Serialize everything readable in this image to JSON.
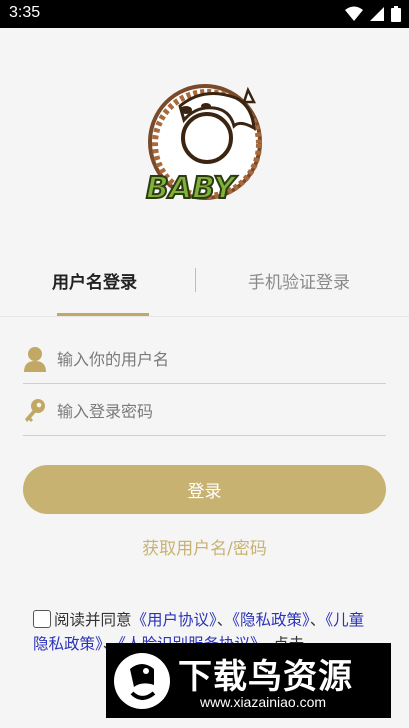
{
  "status_bar": {
    "time": "3:35"
  },
  "logo": {
    "text": "BABY"
  },
  "tabs": [
    {
      "label": "用户名登录",
      "active": true
    },
    {
      "label": "手机验证登录",
      "active": false
    }
  ],
  "form": {
    "username_placeholder": "输入你的用户名",
    "password_placeholder": "输入登录密码",
    "login_label": "登录",
    "retrieve_label": "获取用户名/密码"
  },
  "agreement": {
    "prefix": "阅读并同意",
    "link_user": "《用户协议》",
    "sep1": "、",
    "link_privacy": "《隐私政策》",
    "sep2": "、",
    "link_child": "《儿童隐私政策》",
    "sep3": "、",
    "link_face": "《人脸识别服务协议》",
    "suffix": "，点击"
  },
  "watermark": {
    "title": "下载鸟资源",
    "url": "www.xiazainiao.com"
  },
  "colors": {
    "accent": "#c8b272",
    "link": "#2b33b8",
    "background": "#f5f5f5"
  }
}
